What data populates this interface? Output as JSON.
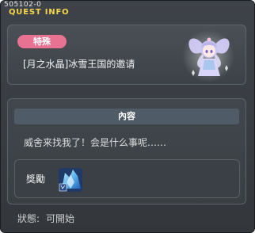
{
  "window": {
    "quest_id": "505102-0",
    "title": "QUEST INFO"
  },
  "quest": {
    "category_badge": "特殊",
    "title": "[月之水晶]冰雪王国的邀请",
    "npc_portrait_icon": "npc-fairy-portrait-icon"
  },
  "content": {
    "section_header": "內容",
    "description": "威舍来找我了！会是什么事呢……"
  },
  "reward": {
    "label": "獎勵",
    "item_icon": "ice-crystal-item-icon"
  },
  "status": {
    "label": "狀態:",
    "value": "可開始"
  },
  "colors": {
    "title_yellow": "#f3d64a",
    "badge_pink": "#e77292",
    "panel_bg": "#3d4248",
    "section_header_bg": "#4f5b66"
  }
}
